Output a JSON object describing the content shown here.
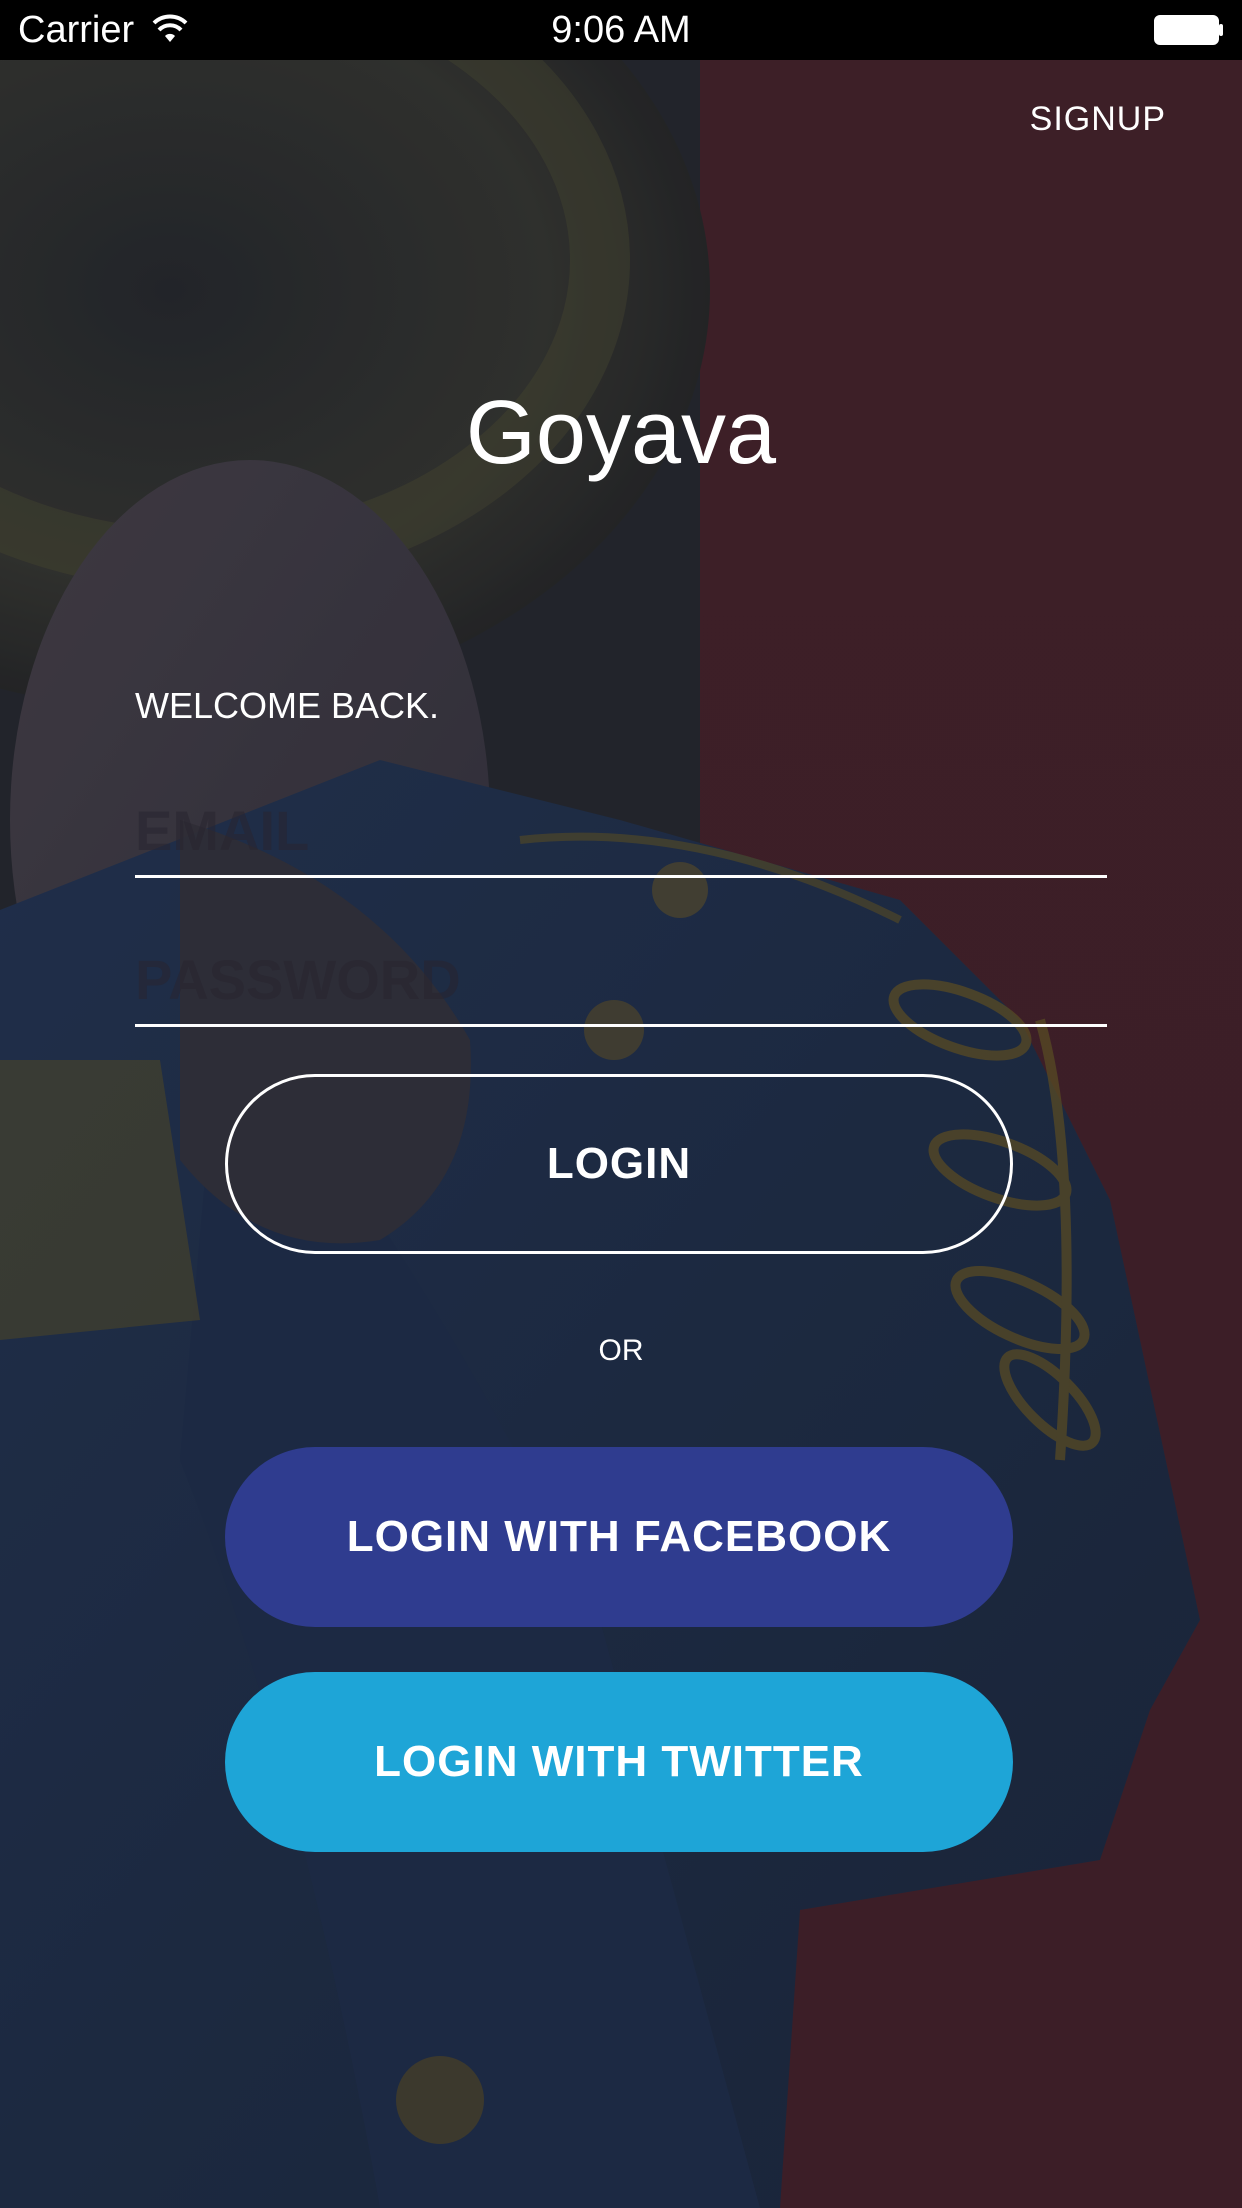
{
  "status_bar": {
    "carrier": "Carrier",
    "time": "9:06 AM",
    "icons": [
      "wifi-icon",
      "battery-icon"
    ]
  },
  "header": {
    "signup_label": "SIGNUP"
  },
  "app": {
    "title": "Goyava"
  },
  "form": {
    "welcome_text": "WELCOME BACK.",
    "email_placeholder": "EMAIL",
    "password_placeholder": "PASSWORD",
    "login_label": "LOGIN",
    "or_text": "OR"
  },
  "social": {
    "facebook_label": "LOGIN WITH FACEBOOK",
    "twitter_label": "LOGIN WITH TWITTER"
  },
  "colors": {
    "facebook": "#2F3C8F",
    "twitter": "#1EA5D7",
    "overlay_red": "#4A2630",
    "overlay_blue": "#24324A"
  }
}
